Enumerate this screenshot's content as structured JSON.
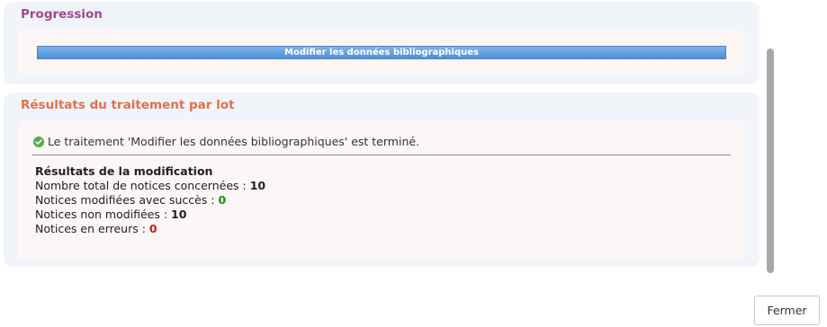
{
  "progress": {
    "title": "Progression",
    "bar_label": "Modifier les données bibliographiques",
    "percent": 100
  },
  "results": {
    "title": "Résultats du traitement par lot",
    "status_message": "Le traitement 'Modifier les données bibliographiques' est terminé.",
    "heading": "Résultats de la modification",
    "rows": [
      {
        "label": "Nombre total de notices concernées : ",
        "value": "10"
      },
      {
        "label": "Notices modifiées avec succès : ",
        "value": "0"
      },
      {
        "label": "Notices non modifiées : ",
        "value": "10"
      },
      {
        "label": "Notices en erreurs : ",
        "value": "0"
      }
    ]
  },
  "footer": {
    "close_label": "Fermer"
  },
  "colors": {
    "progress_title": "#a3478f",
    "results_title": "#e2714b",
    "success": "#1a8a1a",
    "error": "#d11a1a"
  }
}
